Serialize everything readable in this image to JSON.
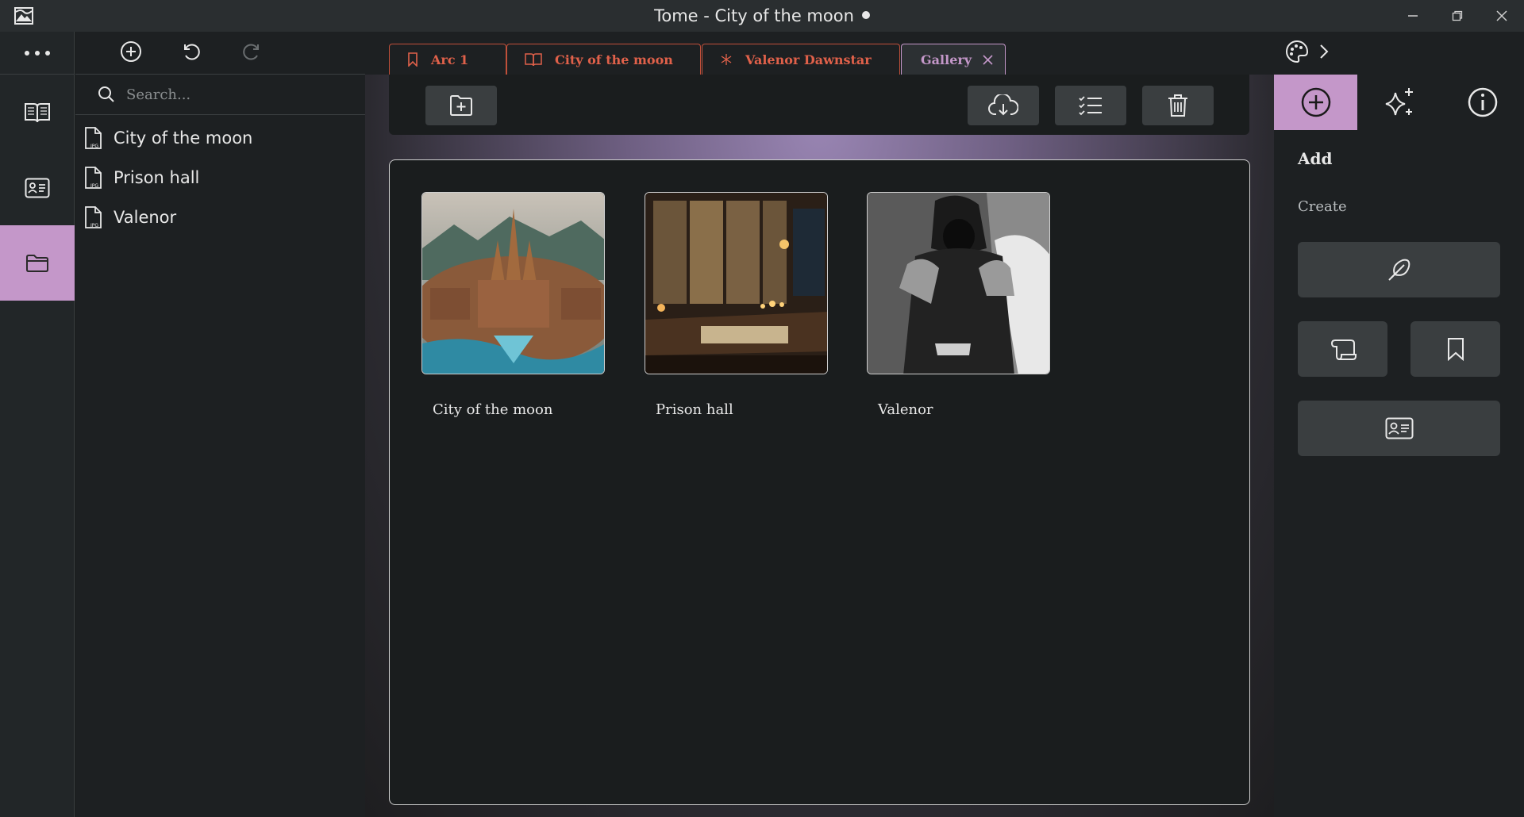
{
  "window": {
    "title": "Tome - City of the moon",
    "icons": [
      "app-logo-icon",
      "minimize-icon",
      "maximize-icon",
      "close-icon"
    ]
  },
  "rail": {
    "items": [
      {
        "name": "more",
        "icon": "more-dots-icon"
      },
      {
        "name": "book",
        "icon": "book-icon"
      },
      {
        "name": "id-card",
        "icon": "id-card-icon"
      },
      {
        "name": "folder",
        "icon": "folder-icon",
        "active": true
      }
    ]
  },
  "files": {
    "toolbar": [
      "add-circle-icon",
      "undo-icon",
      "redo-icon"
    ],
    "search_placeholder": "Search...",
    "items": [
      {
        "label": "City of the moon",
        "icon": "jpg-file-icon"
      },
      {
        "label": "Prison hall",
        "icon": "jpg-file-icon"
      },
      {
        "label": "Valenor",
        "icon": "jpg-file-icon"
      }
    ]
  },
  "tabs": [
    {
      "label": "Arc 1",
      "icon": "bookmark-icon"
    },
    {
      "label": "City of the moon",
      "icon": "book-icon"
    },
    {
      "label": "Valenor Dawnstar",
      "icon": "asterisk-icon"
    },
    {
      "label": "Gallery",
      "icon": "close-icon",
      "active": true
    }
  ],
  "topbar_right": {
    "icons": [
      "palette-icon",
      "chevron-right-icon"
    ]
  },
  "toolbar": {
    "buttons": [
      "add-file-icon",
      "cloud-download-icon",
      "checklist-icon",
      "trash-icon"
    ]
  },
  "gallery": {
    "items": [
      {
        "caption": "City of the moon"
      },
      {
        "caption": "Prison hall"
      },
      {
        "caption": "Valenor"
      }
    ]
  },
  "right_panel": {
    "tabs": [
      "add-circle-icon",
      "sparkles-icon",
      "info-icon"
    ],
    "title": "Add",
    "section": "Create",
    "buttons": [
      "feather-icon",
      "scroll-icon",
      "bookmark-icon",
      "id-card-icon"
    ]
  },
  "colors": {
    "accent": "#c497c9",
    "tab_text": "#e0614a",
    "panel_bg": "#1d2022"
  }
}
